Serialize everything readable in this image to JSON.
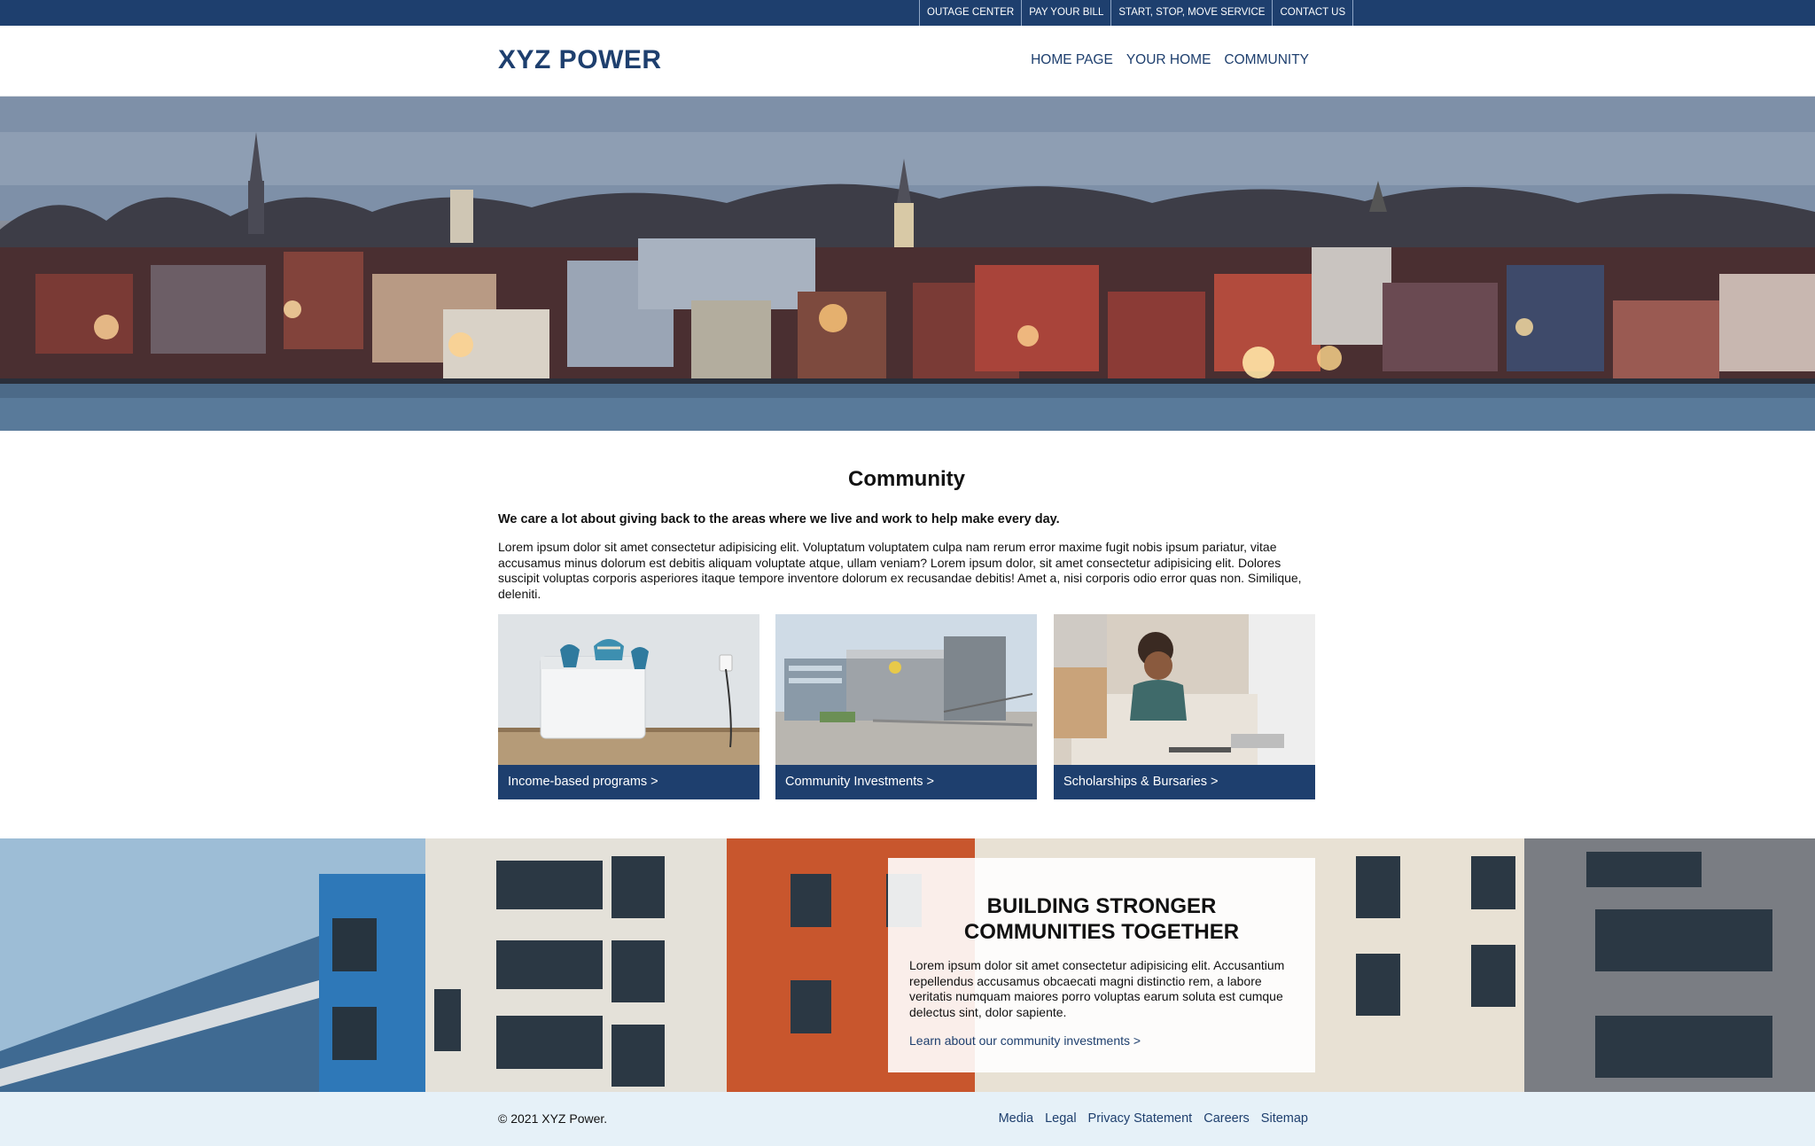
{
  "utility_nav": {
    "items": [
      {
        "label": "OUTAGE CENTER"
      },
      {
        "label": "PAY YOUR BILL"
      },
      {
        "label": "START, STOP, MOVE SERVICE"
      },
      {
        "label": "CONTACT US"
      }
    ]
  },
  "header": {
    "logo": "XYZ POWER",
    "nav": [
      {
        "label": "HOME PAGE"
      },
      {
        "label": "YOUR HOME"
      },
      {
        "label": "COMMUNITY"
      }
    ]
  },
  "main": {
    "title": "Community",
    "lead": "We care a lot about giving back to the areas where we live and work to help make every day.",
    "body": "Lorem ipsum dolor sit amet consectetur adipisicing elit. Voluptatum voluptatem culpa nam rerum error maxime fugit nobis ipsum pariatur, vitae accusamus minus dolorum est debitis aliquam voluptate atque, ullam veniam? Lorem ipsum dolor, sit amet consectetur adipisicing elit. Dolores suscipit voluptas corporis asperiores itaque tempore inventore dolorum ex recusandae debitis! Amet a, nisi corporis odio error quas non. Similique, deleniti.",
    "cards": [
      {
        "label": "Income-based programs >"
      },
      {
        "label": "Community Investments >"
      },
      {
        "label": "Scholarships & Bursaries >"
      }
    ]
  },
  "promo": {
    "title": "BUILDING STRONGER COMMUNITIES TOGETHER",
    "text": "Lorem ipsum dolor sit amet consectetur adipisicing elit. Accusantium repellendus accusamus obcaecati magni distinctio rem, a labore veritatis numquam maiores porro voluptas earum soluta est cumque delectus sint, dolor sapiente.",
    "link": "Learn about our community investments >"
  },
  "footer": {
    "copyright": "© 2021 XYZ Power.",
    "links": [
      {
        "label": "Media"
      },
      {
        "label": "Legal"
      },
      {
        "label": "Privacy Statement"
      },
      {
        "label": "Careers"
      },
      {
        "label": "Sitemap"
      }
    ]
  },
  "colors": {
    "brand": "#1e3f6e",
    "footer_bg": "#e6f1f8"
  }
}
